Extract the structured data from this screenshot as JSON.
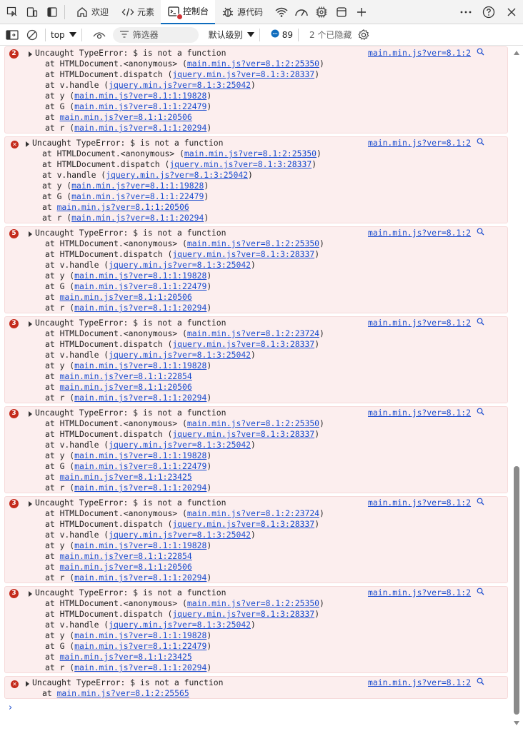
{
  "tabs": [
    {
      "label": "欢迎",
      "icon": "home-icon"
    },
    {
      "label": "元素",
      "icon": "code-icon"
    },
    {
      "label": "控制台",
      "icon": "console-icon",
      "active": true
    },
    {
      "label": "源代码",
      "icon": "bug-icon"
    }
  ],
  "toolbar": {
    "context": "top",
    "filter_placeholder": "筛选器",
    "levels": "默认级别",
    "message_count": "89",
    "hidden": "2 个已隐藏"
  },
  "colors": {
    "accent": "#0f6cbd",
    "error": "#c42b1c",
    "link": "#1a4ccf",
    "error_bg": "#fceeee"
  },
  "entries": [
    {
      "count": "2",
      "message": "Uncaught TypeError: $ is not a function",
      "source": "main.min.js?ver=8.1:2",
      "frames": [
        {
          "pre": "at HTMLDocument.<anonymous> (",
          "link": "main.min.js?ver=8.1:2:25350",
          "post": ")"
        },
        {
          "pre": "at HTMLDocument.dispatch (",
          "link": "jquery.min.js?ver=8.1:3:28337",
          "post": ")"
        },
        {
          "pre": "at v.handle (",
          "link": "jquery.min.js?ver=8.1:3:25042",
          "post": ")"
        },
        {
          "pre": "at y (",
          "link": "main.min.js?ver=8.1:1:19828",
          "post": ")"
        },
        {
          "pre": "at G (",
          "link": "main.min.js?ver=8.1:1:22479",
          "post": ")"
        },
        {
          "pre": "at ",
          "link": "main.min.js?ver=8.1:1:20506",
          "post": ""
        },
        {
          "pre": "at r (",
          "link": "main.min.js?ver=8.1:1:20294",
          "post": ")"
        }
      ]
    },
    {
      "count": "",
      "message": "Uncaught TypeError: $ is not a function",
      "source": "main.min.js?ver=8.1:2",
      "frames": [
        {
          "pre": "at HTMLDocument.<anonymous> (",
          "link": "main.min.js?ver=8.1:2:25350",
          "post": ")"
        },
        {
          "pre": "at HTMLDocument.dispatch (",
          "link": "jquery.min.js?ver=8.1:3:28337",
          "post": ")"
        },
        {
          "pre": "at v.handle (",
          "link": "jquery.min.js?ver=8.1:3:25042",
          "post": ")"
        },
        {
          "pre": "at y (",
          "link": "main.min.js?ver=8.1:1:19828",
          "post": ")"
        },
        {
          "pre": "at G (",
          "link": "main.min.js?ver=8.1:1:22479",
          "post": ")"
        },
        {
          "pre": "at ",
          "link": "main.min.js?ver=8.1:1:20506",
          "post": ""
        },
        {
          "pre": "at r (",
          "link": "main.min.js?ver=8.1:1:20294",
          "post": ")"
        }
      ]
    },
    {
      "count": "5",
      "message": "Uncaught TypeError: $ is not a function",
      "source": "main.min.js?ver=8.1:2",
      "frames": [
        {
          "pre": "at HTMLDocument.<anonymous> (",
          "link": "main.min.js?ver=8.1:2:25350",
          "post": ")"
        },
        {
          "pre": "at HTMLDocument.dispatch (",
          "link": "jquery.min.js?ver=8.1:3:28337",
          "post": ")"
        },
        {
          "pre": "at v.handle (",
          "link": "jquery.min.js?ver=8.1:3:25042",
          "post": ")"
        },
        {
          "pre": "at y (",
          "link": "main.min.js?ver=8.1:1:19828",
          "post": ")"
        },
        {
          "pre": "at G (",
          "link": "main.min.js?ver=8.1:1:22479",
          "post": ")"
        },
        {
          "pre": "at ",
          "link": "main.min.js?ver=8.1:1:20506",
          "post": ""
        },
        {
          "pre": "at r (",
          "link": "main.min.js?ver=8.1:1:20294",
          "post": ")"
        }
      ]
    },
    {
      "count": "3",
      "message": "Uncaught TypeError: $ is not a function",
      "source": "main.min.js?ver=8.1:2",
      "frames": [
        {
          "pre": "at HTMLDocument.<anonymous> (",
          "link": "main.min.js?ver=8.1:2:23724",
          "post": ")"
        },
        {
          "pre": "at HTMLDocument.dispatch (",
          "link": "jquery.min.js?ver=8.1:3:28337",
          "post": ")"
        },
        {
          "pre": "at v.handle (",
          "link": "jquery.min.js?ver=8.1:3:25042",
          "post": ")"
        },
        {
          "pre": "at y (",
          "link": "main.min.js?ver=8.1:1:19828",
          "post": ")"
        },
        {
          "pre": "at ",
          "link": "main.min.js?ver=8.1:1:22854",
          "post": ""
        },
        {
          "pre": "at ",
          "link": "main.min.js?ver=8.1:1:20506",
          "post": ""
        },
        {
          "pre": "at r (",
          "link": "main.min.js?ver=8.1:1:20294",
          "post": ")"
        }
      ]
    },
    {
      "count": "3",
      "message": "Uncaught TypeError: $ is not a function",
      "source": "main.min.js?ver=8.1:2",
      "frames": [
        {
          "pre": "at HTMLDocument.<anonymous> (",
          "link": "main.min.js?ver=8.1:2:25350",
          "post": ")"
        },
        {
          "pre": "at HTMLDocument.dispatch (",
          "link": "jquery.min.js?ver=8.1:3:28337",
          "post": ")"
        },
        {
          "pre": "at v.handle (",
          "link": "jquery.min.js?ver=8.1:3:25042",
          "post": ")"
        },
        {
          "pre": "at y (",
          "link": "main.min.js?ver=8.1:1:19828",
          "post": ")"
        },
        {
          "pre": "at G (",
          "link": "main.min.js?ver=8.1:1:22479",
          "post": ")"
        },
        {
          "pre": "at ",
          "link": "main.min.js?ver=8.1:1:23425",
          "post": ""
        },
        {
          "pre": "at r (",
          "link": "main.min.js?ver=8.1:1:20294",
          "post": ")"
        }
      ]
    },
    {
      "count": "3",
      "message": "Uncaught TypeError: $ is not a function",
      "source": "main.min.js?ver=8.1:2",
      "frames": [
        {
          "pre": "at HTMLDocument.<anonymous> (",
          "link": "main.min.js?ver=8.1:2:23724",
          "post": ")"
        },
        {
          "pre": "at HTMLDocument.dispatch (",
          "link": "jquery.min.js?ver=8.1:3:28337",
          "post": ")"
        },
        {
          "pre": "at v.handle (",
          "link": "jquery.min.js?ver=8.1:3:25042",
          "post": ")"
        },
        {
          "pre": "at y (",
          "link": "main.min.js?ver=8.1:1:19828",
          "post": ")"
        },
        {
          "pre": "at ",
          "link": "main.min.js?ver=8.1:1:22854",
          "post": ""
        },
        {
          "pre": "at ",
          "link": "main.min.js?ver=8.1:1:20506",
          "post": ""
        },
        {
          "pre": "at r (",
          "link": "main.min.js?ver=8.1:1:20294",
          "post": ")"
        }
      ]
    },
    {
      "count": "3",
      "message": "Uncaught TypeError: $ is not a function",
      "source": "main.min.js?ver=8.1:2",
      "frames": [
        {
          "pre": "at HTMLDocument.<anonymous> (",
          "link": "main.min.js?ver=8.1:2:25350",
          "post": ")"
        },
        {
          "pre": "at HTMLDocument.dispatch (",
          "link": "jquery.min.js?ver=8.1:3:28337",
          "post": ")"
        },
        {
          "pre": "at v.handle (",
          "link": "jquery.min.js?ver=8.1:3:25042",
          "post": ")"
        },
        {
          "pre": "at y (",
          "link": "main.min.js?ver=8.1:1:19828",
          "post": ")"
        },
        {
          "pre": "at G (",
          "link": "main.min.js?ver=8.1:1:22479",
          "post": ")"
        },
        {
          "pre": "at ",
          "link": "main.min.js?ver=8.1:1:23425",
          "post": ""
        },
        {
          "pre": "at r (",
          "link": "main.min.js?ver=8.1:1:20294",
          "post": ")"
        }
      ]
    },
    {
      "count": "",
      "message": "Uncaught TypeError: $ is not a function",
      "source": "main.min.js?ver=8.1:2",
      "frames": [
        {
          "pre": "at ",
          "link": "main.min.js?ver=8.1:2:25565",
          "post": ""
        }
      ]
    }
  ],
  "prompt": "›"
}
